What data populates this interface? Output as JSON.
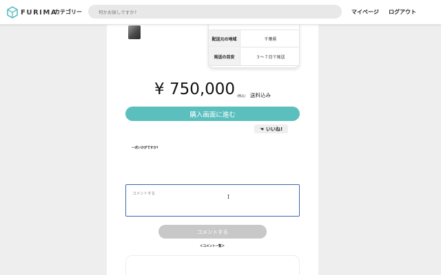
{
  "header": {
    "logo_text": "FURIMA",
    "category_label": "カテゴリー",
    "search_placeholder": "何かお探しですか?",
    "mypage_label": "マイページ",
    "logout_label": "ログアウト"
  },
  "product": {
    "spec": [
      {
        "label": "配送元の地域",
        "value": "千葉県"
      },
      {
        "label": "発送の目安",
        "value": "３〜７日で発送"
      }
    ],
    "price": "¥ 750,000",
    "tax_label": "(税込)",
    "shipping_label": "送料込み",
    "buy_label": "購入画面に進む",
    "like_label": "いいね!"
  },
  "comment": {
    "question": "一式いかがですか?",
    "input_placeholder": "コメントする",
    "submit_label": "コメントする",
    "list_title": "＜コメント一覧＞"
  },
  "colors": {
    "brand_teal": "#5bbfbd",
    "focus_border": "#3a66b3",
    "disabled_button": "#c8c8c8"
  },
  "icons": {
    "logo": "cube-logo-icon",
    "like": "hand-icon",
    "cursor": "text-cursor-icon"
  }
}
